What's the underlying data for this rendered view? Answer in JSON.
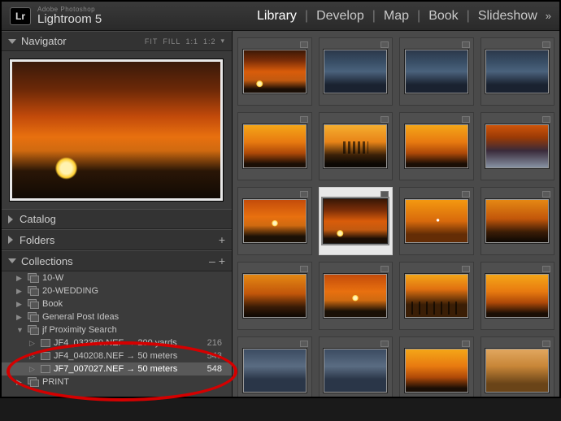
{
  "brand": {
    "logo": "Lr",
    "adobe": "Adobe Photoshop",
    "name": "Lightroom 5"
  },
  "modules": {
    "library": "Library",
    "develop": "Develop",
    "map": "Map",
    "book": "Book",
    "slideshow": "Slideshow",
    "more": "»"
  },
  "navigator": {
    "title": "Navigator",
    "fit": "FIT",
    "fill": "FILL",
    "one": "1:1",
    "zoom": "1:2",
    "zoomdrop": "▾"
  },
  "panels": {
    "catalog": "Catalog",
    "folders": "Folders",
    "collections": "Collections"
  },
  "collections": {
    "items": [
      {
        "label": "10-W"
      },
      {
        "label": "20-WEDDING"
      },
      {
        "label": "Book"
      },
      {
        "label": "General Post Ideas"
      },
      {
        "label": "jf Proximity Search"
      }
    ],
    "prox": [
      {
        "label": "JF4_032369.NEF → 200 yards",
        "count": "216"
      },
      {
        "label": "JF4_040208.NEF → 50 meters",
        "count": "543"
      },
      {
        "label": "JF7_007027.NEF → 50 meters",
        "count": "548"
      }
    ],
    "print": "PRINT"
  }
}
